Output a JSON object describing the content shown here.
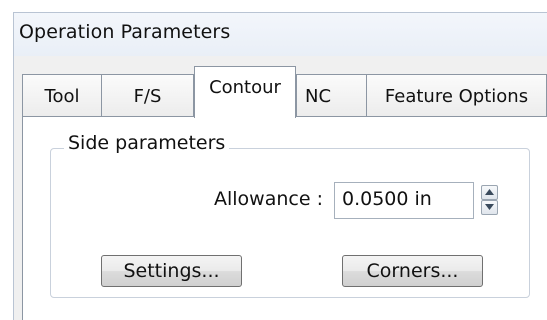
{
  "window": {
    "title": "Operation Parameters"
  },
  "tabs": [
    {
      "label": "Tool",
      "active": false
    },
    {
      "label": "F/S",
      "active": false
    },
    {
      "label": "Contour",
      "active": true
    },
    {
      "label": "NC",
      "active": false
    },
    {
      "label": "Feature Options",
      "active": false
    }
  ],
  "side_parameters": {
    "group_title": "Side parameters",
    "allowance_label": "Allowance :",
    "allowance_value": "0.0500 in"
  },
  "buttons": {
    "settings_label": "Settings...",
    "corners_label": "Corners..."
  },
  "icons": {
    "spinner_up": "chevron-up-icon",
    "spinner_down": "chevron-down-icon"
  }
}
